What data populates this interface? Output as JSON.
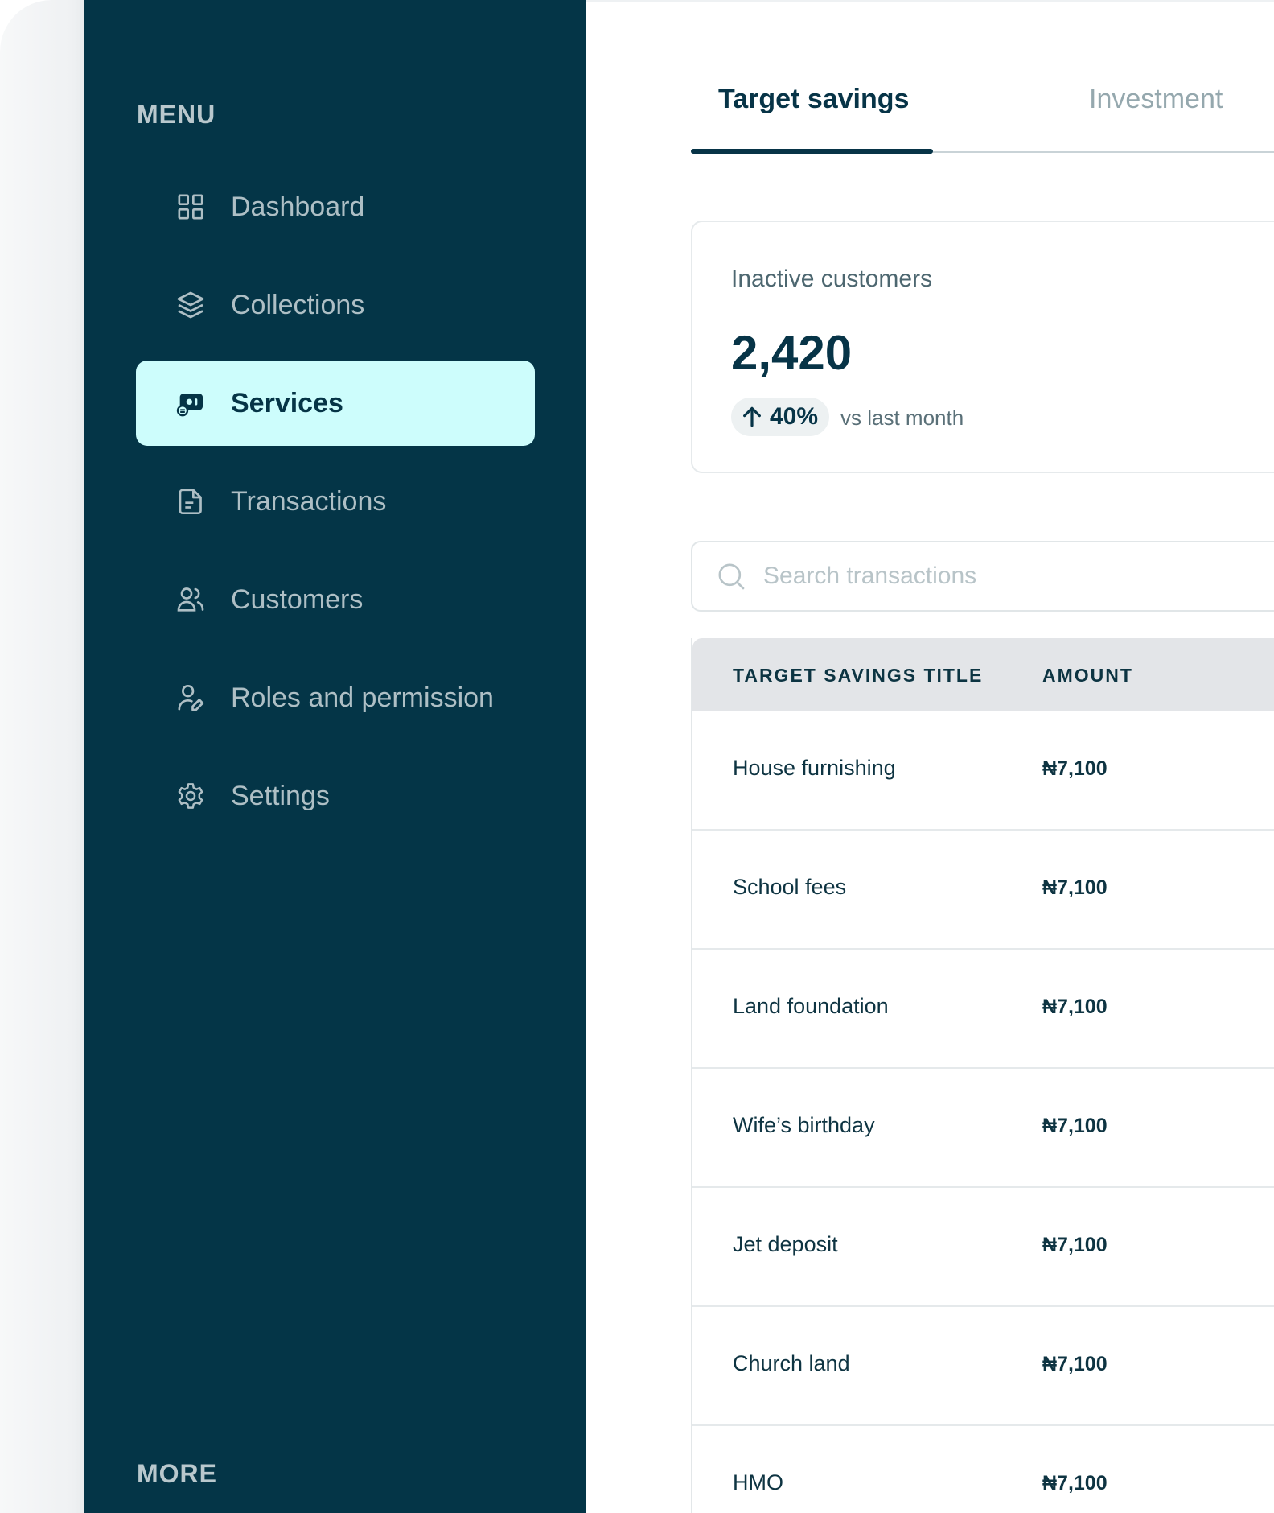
{
  "sidebar": {
    "menu_heading": "MENU",
    "more_heading": "MORE",
    "items": [
      {
        "label": "Dashboard",
        "icon": "grid-icon",
        "active": false
      },
      {
        "label": "Collections",
        "icon": "layers-icon",
        "active": false
      },
      {
        "label": "Services",
        "icon": "services-icon",
        "active": true
      },
      {
        "label": "Transactions",
        "icon": "document-icon",
        "active": false
      },
      {
        "label": "Customers",
        "icon": "users-icon",
        "active": false
      },
      {
        "label": "Roles and permission",
        "icon": "user-edit-icon",
        "active": false
      },
      {
        "label": "Settings",
        "icon": "gear-icon",
        "active": false
      }
    ]
  },
  "tabs": [
    {
      "label": "Target savings",
      "active": true
    },
    {
      "label": "Investment",
      "active": false
    }
  ],
  "stat_card": {
    "label": "Inactive customers",
    "value": "2,420",
    "trend": "40%",
    "trend_direction": "up",
    "trend_caption": "vs last month"
  },
  "search": {
    "placeholder": "Search transactions",
    "value": ""
  },
  "table": {
    "columns": [
      "TARGET SAVINGS TITLE",
      "AMOUNT"
    ],
    "rows": [
      {
        "title": "House furnishing",
        "amount": "₦7,100"
      },
      {
        "title": "School fees",
        "amount": "₦7,100"
      },
      {
        "title": "Land foundation",
        "amount": "₦7,100"
      },
      {
        "title": "Wife’s birthday",
        "amount": "₦7,100"
      },
      {
        "title": "Jet deposit",
        "amount": "₦7,100"
      },
      {
        "title": "Church land",
        "amount": "₦7,100"
      },
      {
        "title": "HMO",
        "amount": "₦7,100"
      }
    ]
  },
  "colors": {
    "sidebar_bg": "#043547",
    "active_item_bg": "#cdfdfc",
    "primary_text": "#073447",
    "muted_text": "#aebfc5"
  }
}
